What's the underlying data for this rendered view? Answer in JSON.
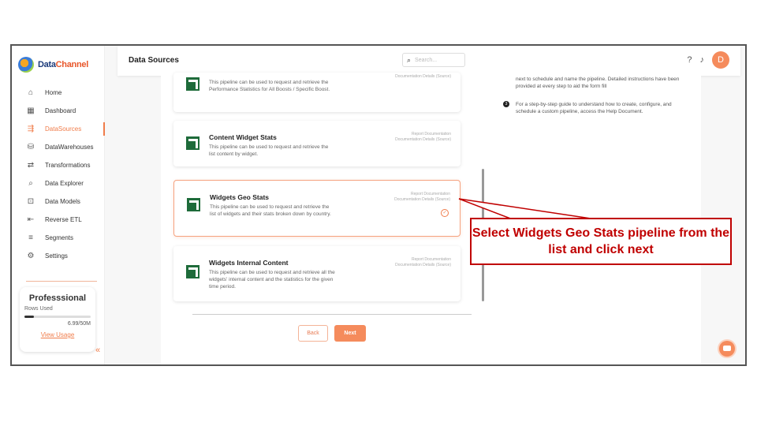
{
  "logo": {
    "part1": "Data",
    "part2": "Channel"
  },
  "nav": [
    {
      "label": "Home",
      "icon": "⌂"
    },
    {
      "label": "Dashboard",
      "icon": "▦"
    },
    {
      "label": "DataSources",
      "icon": "⇶"
    },
    {
      "label": "DataWarehouses",
      "icon": "⛁"
    },
    {
      "label": "Transformations",
      "icon": "⇄"
    },
    {
      "label": "Data Explorer",
      "icon": "⌕"
    },
    {
      "label": "Data Models",
      "icon": "⊡"
    },
    {
      "label": "Reverse ETL",
      "icon": "⇤"
    },
    {
      "label": "Segments",
      "icon": "≡"
    },
    {
      "label": "Settings",
      "icon": "⚙"
    }
  ],
  "plan": {
    "name": "Professsional",
    "rows_label": "Rows Used",
    "usage": "6.99/50M",
    "usage_fraction": 0.14,
    "link": "View Usage"
  },
  "header": {
    "title": "Data Sources",
    "search_placeholder": "Search..."
  },
  "cards": [
    {
      "title": "",
      "desc": "This pipeline can be used to request and retrieve the Performance Statistics for All Boosts / Specific Boost.",
      "links": "Documentation Details (Source)"
    },
    {
      "title": "Content Widget Stats",
      "desc": "This pipeline can be used to request and retrieve the list content by widget.",
      "links": "Report Documentation\nDocumentation Details (Source)"
    },
    {
      "title": "Widgets Geo Stats",
      "desc": "This pipeline can be used to request and retrieve the list of widgets and their stats broken down by country.",
      "links": "Report Documentation\nDocumentation Details (Source)"
    },
    {
      "title": "Widgets Internal Content",
      "desc": "This pipeline can be used to request and retrieve all the widgets' internal content and the statistics for the given time period.",
      "links": "Report Documentation\nDocumentation Details (Source)"
    }
  ],
  "buttons": {
    "back": "Back",
    "next": "Next"
  },
  "instructions": {
    "step2_text": "next to schedule and name the pipeline. Detailed instructions have been provided at every step to aid the form fill",
    "step3_num": "3",
    "step3_text": "For a step-by-step guide to understand how to create, configure, and schedule a custom pipeline, access the Help Document."
  },
  "avatar_letter": "D",
  "callout": "Select Widgets Geo Stats pipeline from the list and click next",
  "colors": {
    "accent": "#f07c4a",
    "callout": "#c00000"
  }
}
